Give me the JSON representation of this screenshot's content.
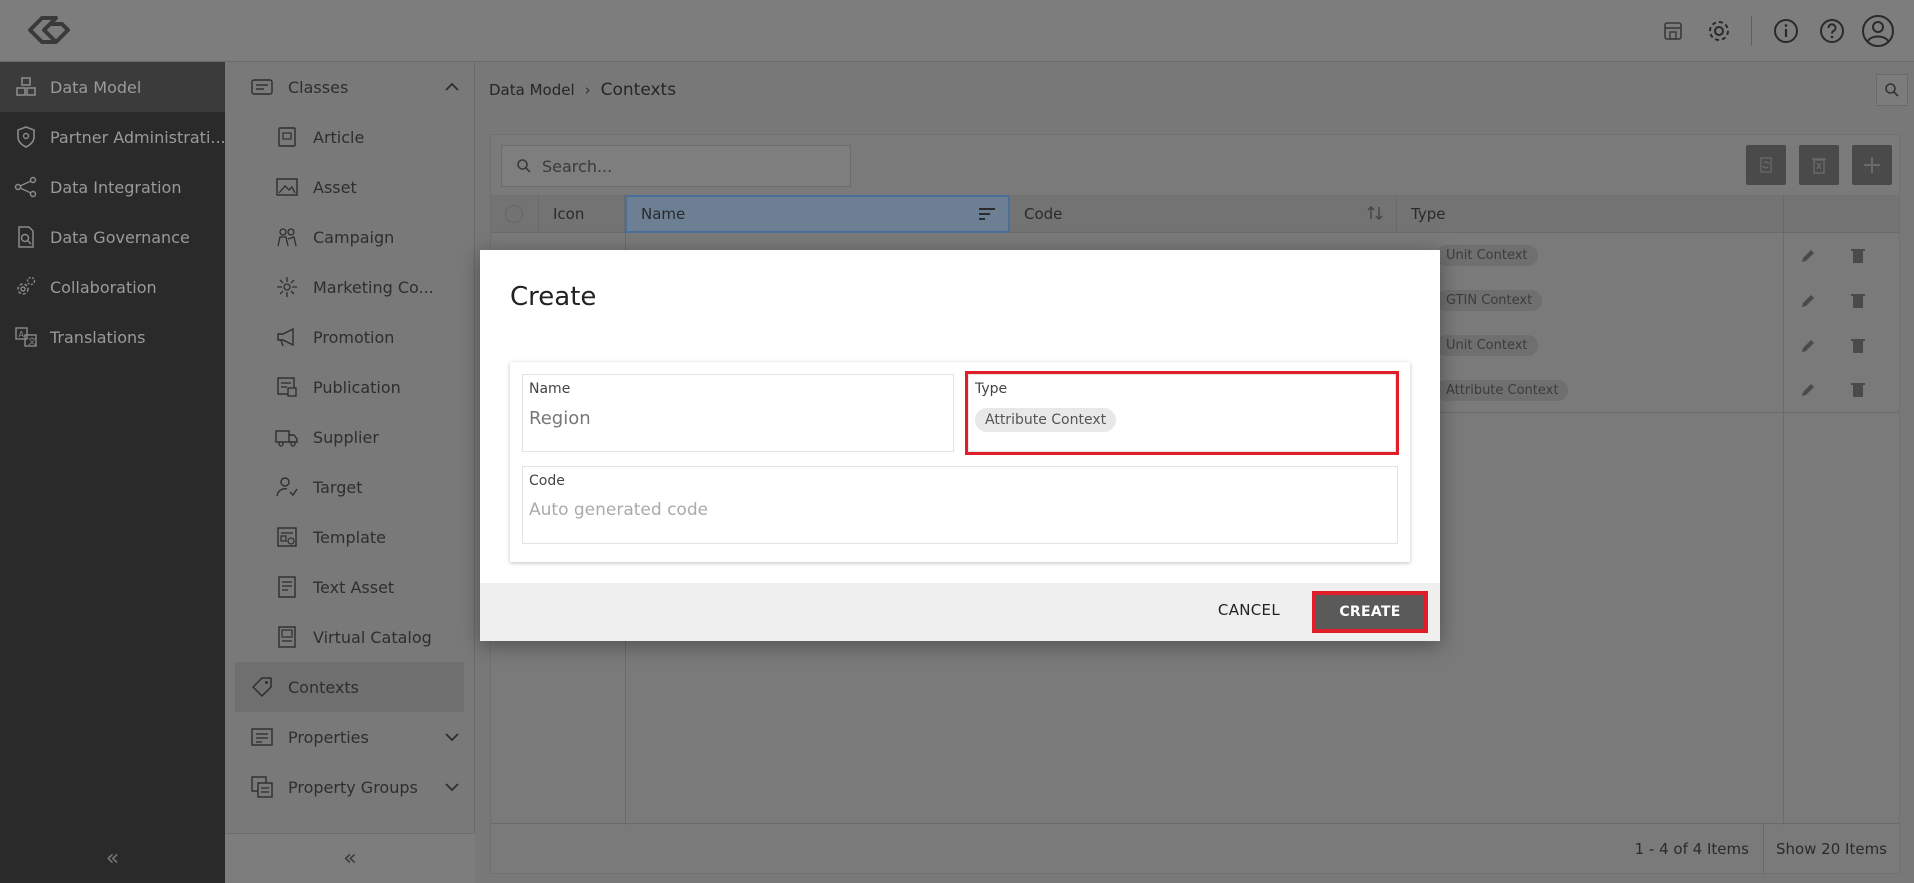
{
  "topbar": {
    "icons": [
      "store-icon",
      "gear-icon",
      "info-icon",
      "help-icon",
      "user-avatar-icon"
    ]
  },
  "leftnav": {
    "items": [
      {
        "label": "Data Model",
        "icon": "cubes-icon",
        "active": true
      },
      {
        "label": "Partner Administrati...",
        "icon": "shield-icon"
      },
      {
        "label": "Data Integration",
        "icon": "nodes-icon"
      },
      {
        "label": "Data Governance",
        "icon": "document-search-icon"
      },
      {
        "label": "Collaboration",
        "icon": "gears-icon"
      },
      {
        "label": "Translations",
        "icon": "translate-icon"
      }
    ],
    "collapse": "«"
  },
  "subnav": {
    "classes": {
      "label": "Classes",
      "expanded": true
    },
    "children": [
      {
        "label": "Article"
      },
      {
        "label": "Asset"
      },
      {
        "label": "Campaign"
      },
      {
        "label": "Marketing Co..."
      },
      {
        "label": "Promotion"
      },
      {
        "label": "Publication"
      },
      {
        "label": "Supplier"
      },
      {
        "label": "Target"
      },
      {
        "label": "Template"
      },
      {
        "label": "Text Asset"
      },
      {
        "label": "Virtual Catalog"
      }
    ],
    "contexts": {
      "label": "Contexts"
    },
    "properties": {
      "label": "Properties"
    },
    "property_groups": {
      "label": "Property Groups"
    },
    "collapse": "«"
  },
  "main": {
    "breadcrumb": {
      "root": "Data Model",
      "separator": "›",
      "current": "Contexts"
    },
    "search": {
      "placeholder": "Search..."
    },
    "table": {
      "columns": {
        "icon": "Icon",
        "name": "Name",
        "code": "Code",
        "type": "Type"
      },
      "rows": [
        {
          "type": "Unit Context"
        },
        {
          "type": "GTIN Context"
        },
        {
          "type": "Unit Context"
        },
        {
          "type": "Attribute Context"
        }
      ]
    },
    "footer": {
      "range": "1 - 4 of 4 Items",
      "page_size": "Show 20 Items"
    }
  },
  "modal": {
    "title": "Create",
    "name_field": {
      "label": "Name",
      "value": "Region"
    },
    "type_field": {
      "label": "Type",
      "value": "Attribute Context"
    },
    "code_field": {
      "label": "Code",
      "placeholder": "Auto generated code"
    },
    "cancel": "CANCEL",
    "create": "CREATE"
  },
  "colors": {
    "highlight": "#e11d2a",
    "leftnav_bg": "#2a2a2a",
    "create_bg": "#5a5a5a"
  }
}
